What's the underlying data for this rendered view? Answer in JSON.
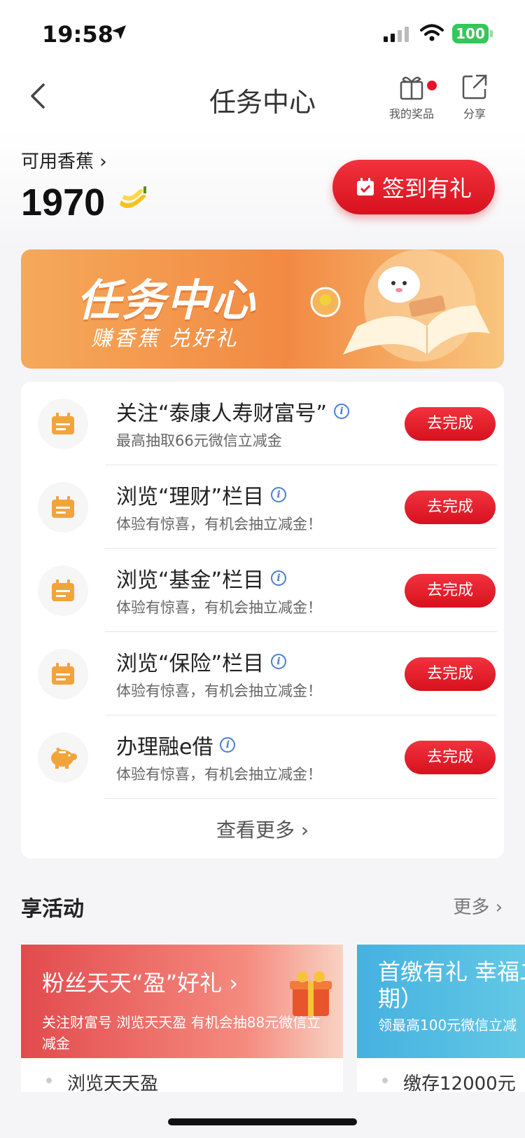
{
  "status": {
    "time": "19:58",
    "battery": "100"
  },
  "nav": {
    "title": "任务中心",
    "prize_label": "我的奖品",
    "share_label": "分享"
  },
  "balance": {
    "label": "可用香蕉 ›",
    "value": "1970"
  },
  "checkin": {
    "label": "签到有礼"
  },
  "banner": {
    "title": "任务中心",
    "subtitle": "赚香蕉 兑好礼"
  },
  "tasks": [
    {
      "title": "关注“泰康人寿财富号”",
      "desc": "最高抽取66元微信立减金",
      "button": "去完成",
      "icon": "calendar-icon"
    },
    {
      "title": "浏览“理财”栏目",
      "desc": "体验有惊喜，有机会抽立减金！",
      "button": "去完成",
      "icon": "calendar-icon"
    },
    {
      "title": "浏览“基金”栏目",
      "desc": "体验有惊喜，有机会抽立减金！",
      "button": "去完成",
      "icon": "calendar-icon"
    },
    {
      "title": "浏览“保险”栏目",
      "desc": "体验有惊喜，有机会抽立减金！",
      "button": "去完成",
      "icon": "calendar-icon"
    },
    {
      "title": "办理融e借",
      "desc": "体验有惊喜，有机会抽立减金！",
      "button": "去完成",
      "icon": "piggy-bank-icon"
    }
  ],
  "more_tasks": "查看更多 ›",
  "activities": {
    "title": "享活动",
    "more": "更多 ›",
    "items": [
      {
        "title": "粉丝天天“盈”好礼 ›",
        "desc": "关注财富号 浏览天天盈 有机会抽88元微信立减金",
        "footer": "浏览天天盈"
      },
      {
        "title": "首缴有礼 幸福二期）",
        "desc": "领最高100元微信立减",
        "footer": "缴存12000元"
      }
    ]
  },
  "colors": {
    "accent_red": "#e8132b",
    "banner_orange": "#f28a43"
  }
}
